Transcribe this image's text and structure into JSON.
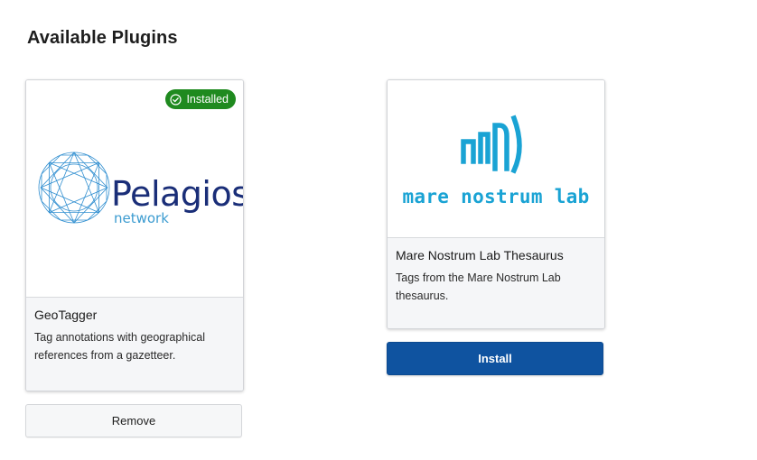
{
  "page": {
    "title": "Available Plugins"
  },
  "plugins": [
    {
      "id": "geotagger",
      "name": "GeoTagger",
      "description": "Tag annotations with geographical references from a gazetteer.",
      "status_badge": "Installed",
      "action_label": "Remove",
      "logo": {
        "wordmark": "Pelagios",
        "subtext": "network",
        "icon": "geodesic-sphere-icon"
      }
    },
    {
      "id": "mare-nostrum-lab",
      "name": "Mare Nostrum Lab Thesaurus",
      "description": "Tags from the Mare Nostrum Lab thesaurus.",
      "action_label": "Install",
      "logo": {
        "wordmark": "mare nostrum lab",
        "icon": "signal-waves-icon"
      }
    }
  ],
  "colors": {
    "installed_badge": "#1f8a1f",
    "install_button": "#0f53a0",
    "pelagios_navy": "#1a2e78",
    "pelagios_blue": "#3b9bd0",
    "mnl_cyan": "#1aa3d4"
  }
}
